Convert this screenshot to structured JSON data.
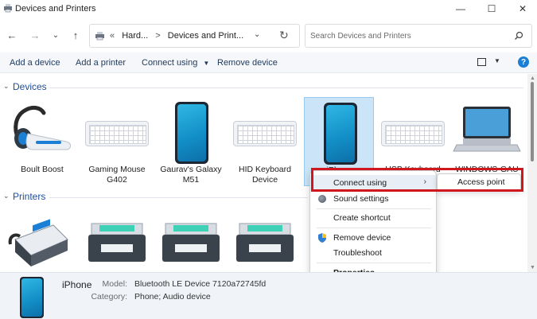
{
  "window": {
    "title": "Devices and Printers"
  },
  "address": {
    "crumbs": [
      "«",
      "Hard...",
      ">",
      "Devices and Print..."
    ],
    "search_placeholder": "Search Devices and Printers"
  },
  "commands": {
    "add_device": "Add a device",
    "add_printer": "Add a printer",
    "connect_using": "Connect using",
    "remove_device": "Remove device"
  },
  "groups": {
    "devices_label": "Devices",
    "printers_label": "Printers"
  },
  "devices": [
    {
      "label": "Boult Boost",
      "icon": "headset-icon"
    },
    {
      "label": "Gaming Mouse G402",
      "icon": "keyboard-icon"
    },
    {
      "label": "Gaurav's Galaxy M51",
      "icon": "phone-icon"
    },
    {
      "label": "HID Keyboard Device",
      "icon": "keyboard-icon"
    },
    {
      "label": "iPhone",
      "icon": "phone-icon",
      "selected": true
    },
    {
      "label": "USB Keyboard",
      "icon": "keyboard-icon"
    },
    {
      "label": "WINDOWS-GAU",
      "icon": "laptop-icon"
    }
  ],
  "printers": [
    {
      "icon": "fax-icon"
    },
    {
      "icon": "printer-icon"
    },
    {
      "icon": "printer-icon"
    },
    {
      "icon": "printer-icon"
    }
  ],
  "context_menu": {
    "items": [
      "Connect using",
      "Sound settings",
      "Create shortcut",
      "Remove device",
      "Troubleshoot",
      "Properties"
    ],
    "submenu": [
      "Access point"
    ]
  },
  "details": {
    "name": "iPhone",
    "model_key": "Model:",
    "model_value": "Bluetooth LE Device 7120a72745fd",
    "category_key": "Category:",
    "category_value": "Phone; Audio device"
  },
  "colors": {
    "accent": "#1e4e9a",
    "highlight_border": "#d0161e",
    "selection": "#cce4f7"
  }
}
